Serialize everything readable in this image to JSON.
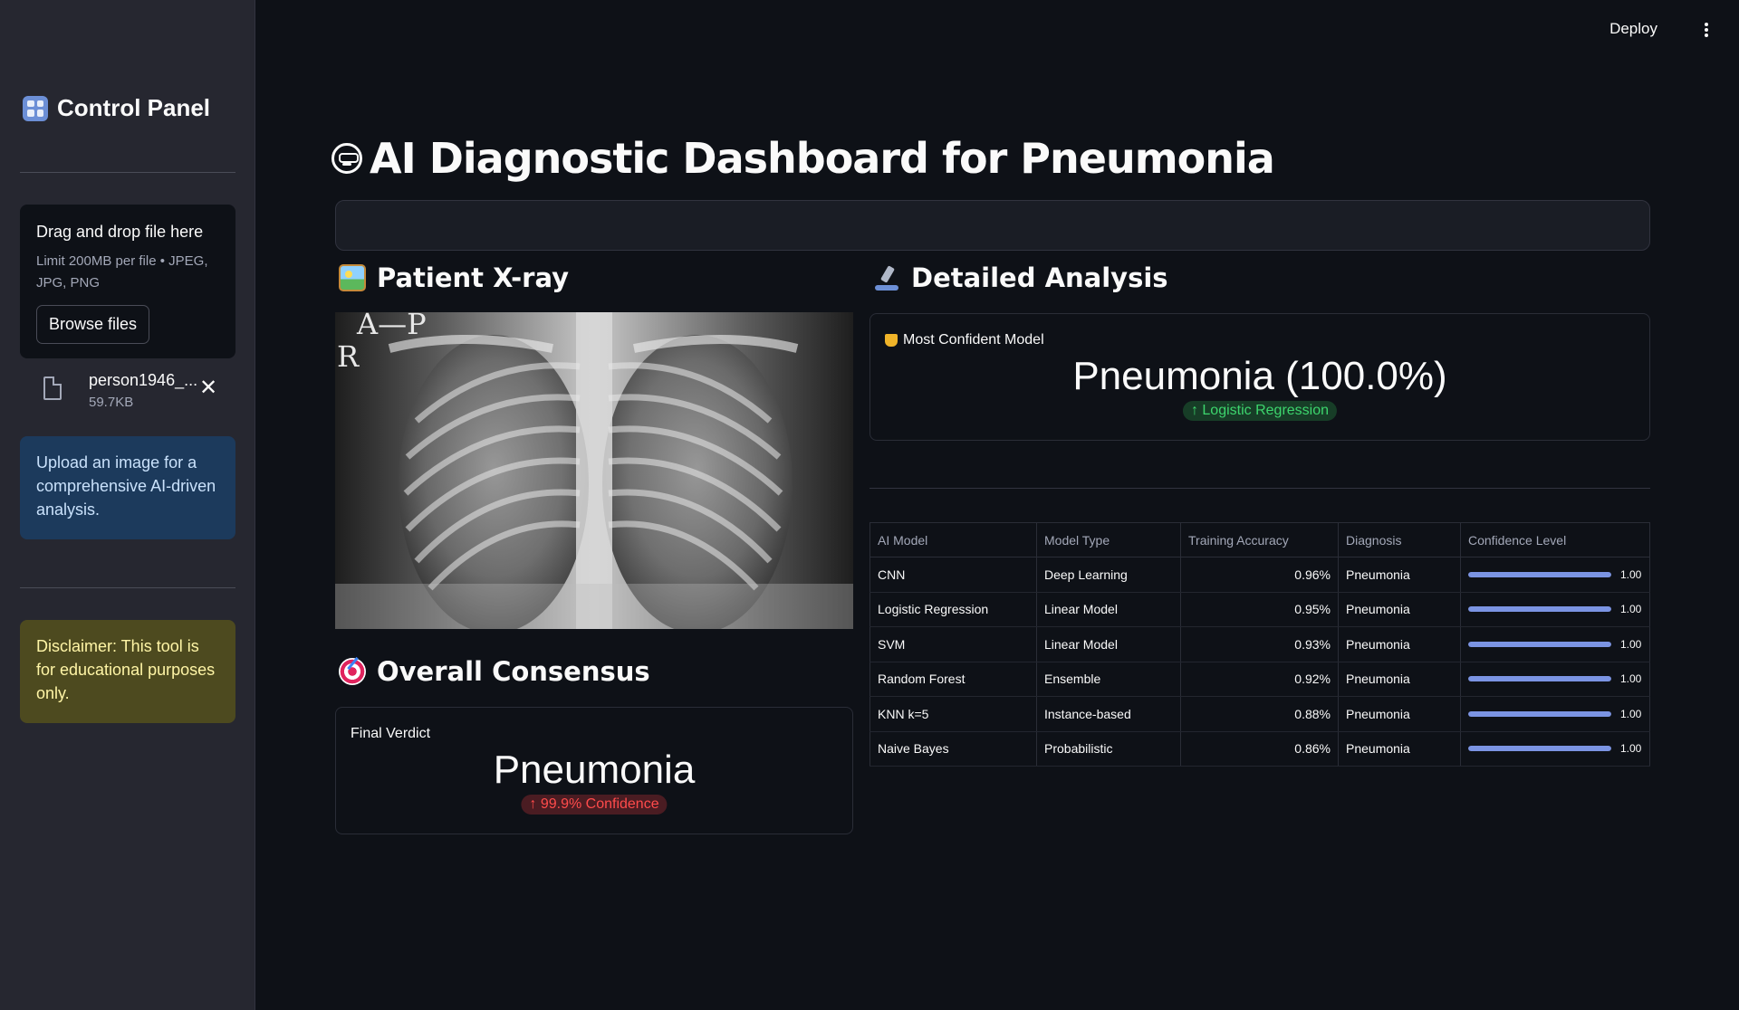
{
  "sidebar": {
    "title": "Control Panel",
    "uploader": {
      "title": "Drag and drop file here",
      "limit": "Limit 200MB per file • JPEG, JPG, PNG",
      "browse_label": "Browse files"
    },
    "file": {
      "name": "person1946_...",
      "size": "59.7KB"
    },
    "info": "Upload an image for a comprehensive AI-driven analysis.",
    "disclaimer": "Disclaimer: This tool is for educational purposes only."
  },
  "header": {
    "deploy_label": "Deploy"
  },
  "main": {
    "title": "AI Diagnostic Dashboard for Pneumonia",
    "xray_section": "Patient X-ray",
    "xray_labels": {
      "view": "A—P",
      "side": "R"
    },
    "consensus_section": "Overall Consensus",
    "consensus": {
      "label": "Final Verdict",
      "value": "Pneumonia",
      "delta": "↑ 99.9% Confidence"
    },
    "analysis_section": "Detailed Analysis",
    "top_model": {
      "label": "Most Confident Model",
      "value": "Pneumonia (100.0%)",
      "delta": "↑ Logistic Regression"
    },
    "table": {
      "headers": [
        "AI Model",
        "Model Type",
        "Training Accuracy",
        "Diagnosis",
        "Confidence Level"
      ],
      "rows": [
        {
          "model": "CNN",
          "type": "Deep Learning",
          "acc": "0.96%",
          "diagnosis": "Pneumonia",
          "conf": "1.00",
          "conf_level": 1.0
        },
        {
          "model": "Logistic Regression",
          "type": "Linear Model",
          "acc": "0.95%",
          "diagnosis": "Pneumonia",
          "conf": "1.00",
          "conf_level": 1.0
        },
        {
          "model": "SVM",
          "type": "Linear Model",
          "acc": "0.93%",
          "diagnosis": "Pneumonia",
          "conf": "1.00",
          "conf_level": 1.0
        },
        {
          "model": "Random Forest",
          "type": "Ensemble",
          "acc": "0.92%",
          "diagnosis": "Pneumonia",
          "conf": "1.00",
          "conf_level": 1.0
        },
        {
          "model": "KNN k=5",
          "type": "Instance-based",
          "acc": "0.88%",
          "diagnosis": "Pneumonia",
          "conf": "1.00",
          "conf_level": 1.0
        },
        {
          "model": "Naive Bayes",
          "type": "Probabilistic",
          "acc": "0.86%",
          "diagnosis": "Pneumonia",
          "conf": "1.00",
          "conf_level": 1.0
        }
      ]
    }
  },
  "colors": {
    "background": "#0e1117",
    "sidebar": "#262730",
    "accent_bar": "#7b94e3",
    "positive": "#3dd56d",
    "negative": "#ff4b4b",
    "info_bg": "#1c3a5c",
    "warning_bg": "#4d4a1f"
  },
  "icons": {
    "sidebar_title": "control-knobs-icon",
    "page_title": "robot-face-icon",
    "xray_section": "framed-picture-icon",
    "analysis_section": "microscope-icon",
    "consensus_section": "direct-hit-icon",
    "top_model": "trophy-icon",
    "file": "file-icon",
    "remove_file": "close-icon",
    "menu": "kebab-menu-icon"
  }
}
